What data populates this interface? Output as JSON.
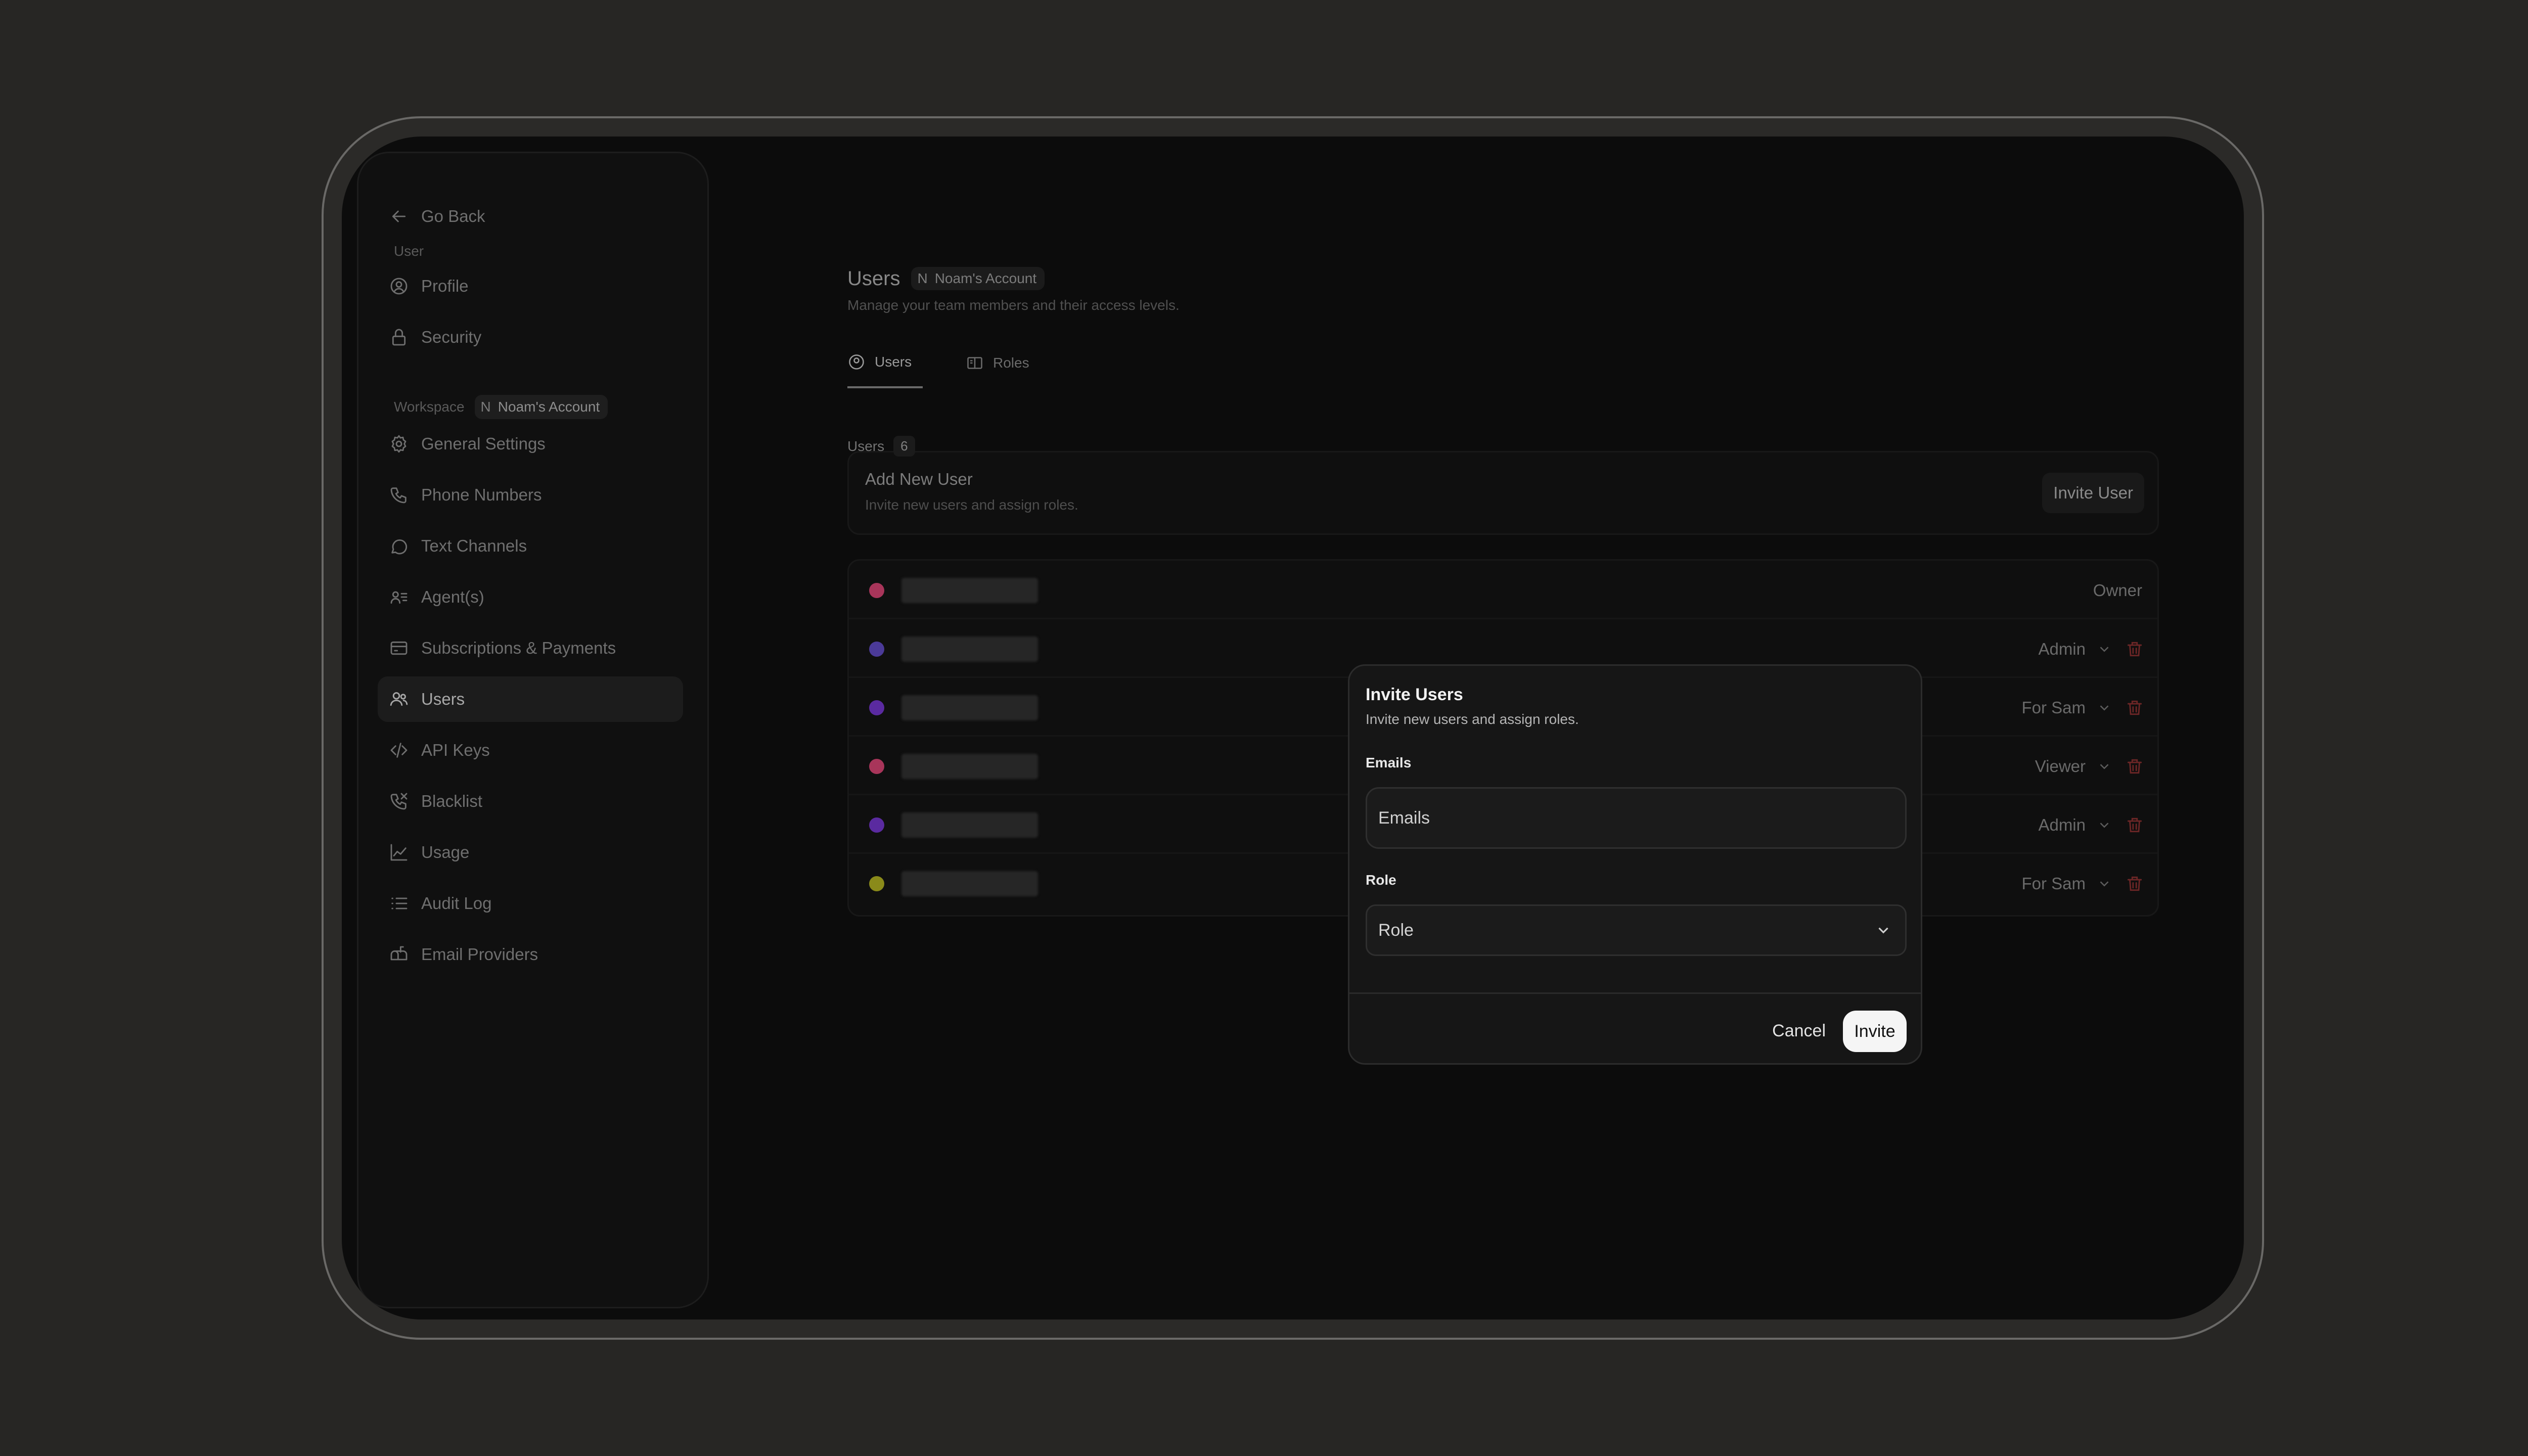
{
  "sidebar": {
    "go_back": "Go Back",
    "user_section": "User",
    "workspace_section": "Workspace",
    "workspace_badge_initial": "N",
    "workspace_badge_name": "Noam's Account",
    "items": [
      {
        "label": "Profile",
        "icon": "user-circle-icon"
      },
      {
        "label": "Security",
        "icon": "lock-icon"
      },
      {
        "label": "General Settings",
        "icon": "gear-icon"
      },
      {
        "label": "Phone Numbers",
        "icon": "phone-icon"
      },
      {
        "label": "Text Channels",
        "icon": "chat-bubble-icon"
      },
      {
        "label": "Agent(s)",
        "icon": "agent-list-icon"
      },
      {
        "label": "Subscriptions & Payments",
        "icon": "credit-card-icon"
      },
      {
        "label": "Users",
        "icon": "users-icon",
        "active": true
      },
      {
        "label": "API Keys",
        "icon": "code-icon"
      },
      {
        "label": "Blacklist",
        "icon": "phone-blocked-icon"
      },
      {
        "label": "Usage",
        "icon": "chart-line-icon"
      },
      {
        "label": "Audit Log",
        "icon": "list-icon"
      },
      {
        "label": "Email Providers",
        "icon": "mailbox-icon"
      }
    ]
  },
  "header": {
    "title": "Users",
    "account_initial": "N",
    "account_name": "Noam's Account",
    "subtitle": "Manage your team members and their access levels."
  },
  "tabs": [
    {
      "label": "Users",
      "icon": "user-gear-icon",
      "active": true
    },
    {
      "label": "Roles",
      "icon": "roles-book-icon"
    }
  ],
  "add_user": {
    "title": "Add New User",
    "subtitle": "Invite new users and assign roles.",
    "button": "Invite User"
  },
  "users_list": {
    "label": "Users",
    "count": "6",
    "rows": [
      {
        "color": "#a8355a",
        "role": "Owner",
        "editable": false
      },
      {
        "color": "#4b3a98",
        "role": "Admin",
        "editable": true
      },
      {
        "color": "#5a2aa0",
        "role": "For Sam",
        "editable": true
      },
      {
        "color": "#a8355a",
        "role": "Viewer",
        "editable": true
      },
      {
        "color": "#5a2aa0",
        "role": "Admin",
        "editable": true
      },
      {
        "color": "#8a8a1a",
        "role": "For Sam",
        "editable": true
      }
    ]
  },
  "modal": {
    "title": "Invite Users",
    "subtitle": "Invite new users and assign roles.",
    "emails_label": "Emails",
    "emails_placeholder": "Emails",
    "role_label": "Role",
    "role_placeholder": "Role",
    "cancel": "Cancel",
    "invite": "Invite"
  }
}
